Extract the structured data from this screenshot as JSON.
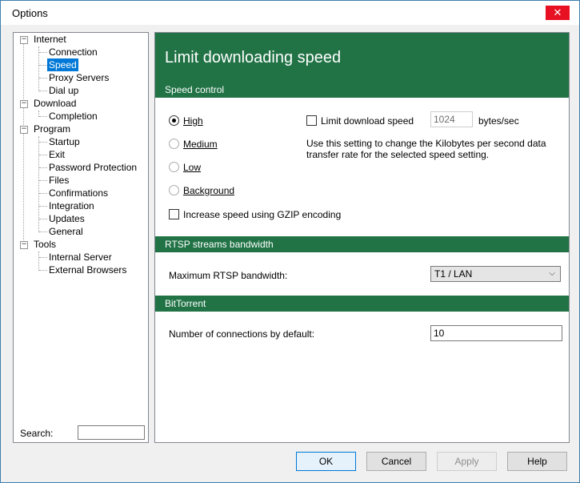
{
  "window": {
    "title": "Options",
    "close_glyph": "✕"
  },
  "tree": {
    "internet": "Internet",
    "connection": "Connection",
    "speed": "Speed",
    "proxy_servers": "Proxy Servers",
    "dial_up": "Dial up",
    "download": "Download",
    "completion": "Completion",
    "program": "Program",
    "startup": "Startup",
    "exit": "Exit",
    "password_protection": "Password Protection",
    "files": "Files",
    "confirmations": "Confirmations",
    "integration": "Integration",
    "updates": "Updates",
    "general": "General",
    "tools": "Tools",
    "internal_server": "Internal Server",
    "external_browsers": "External Browsers",
    "expander_glyph": "−",
    "selected_color": "#0078d7"
  },
  "search": {
    "label": "Search:",
    "value": ""
  },
  "panel": {
    "title": "Limit downloading speed",
    "header_color": "#217346",
    "speed_control": {
      "header": "Speed control",
      "high": "High",
      "medium": "Medium",
      "low": "Low",
      "background": "Background",
      "selected": "High",
      "gzip_label": "Increase speed using GZIP encoding",
      "gzip_checked": false,
      "limit_label": "Limit download speed",
      "limit_checked": false,
      "limit_value": "1024",
      "limit_unit": "bytes/sec",
      "hint": "Use this setting to change the Kilobytes per second data transfer rate for the selected speed setting."
    },
    "rtsp": {
      "header": "RTSP streams bandwidth",
      "label": "Maximum RTSP bandwidth:",
      "selected": "T1 / LAN"
    },
    "bittorrent": {
      "header": "BitTorrent",
      "label": "Number of connections by default:",
      "value": "10"
    }
  },
  "buttons": {
    "ok": "OK",
    "cancel": "Cancel",
    "apply": "Apply",
    "help": "Help"
  }
}
